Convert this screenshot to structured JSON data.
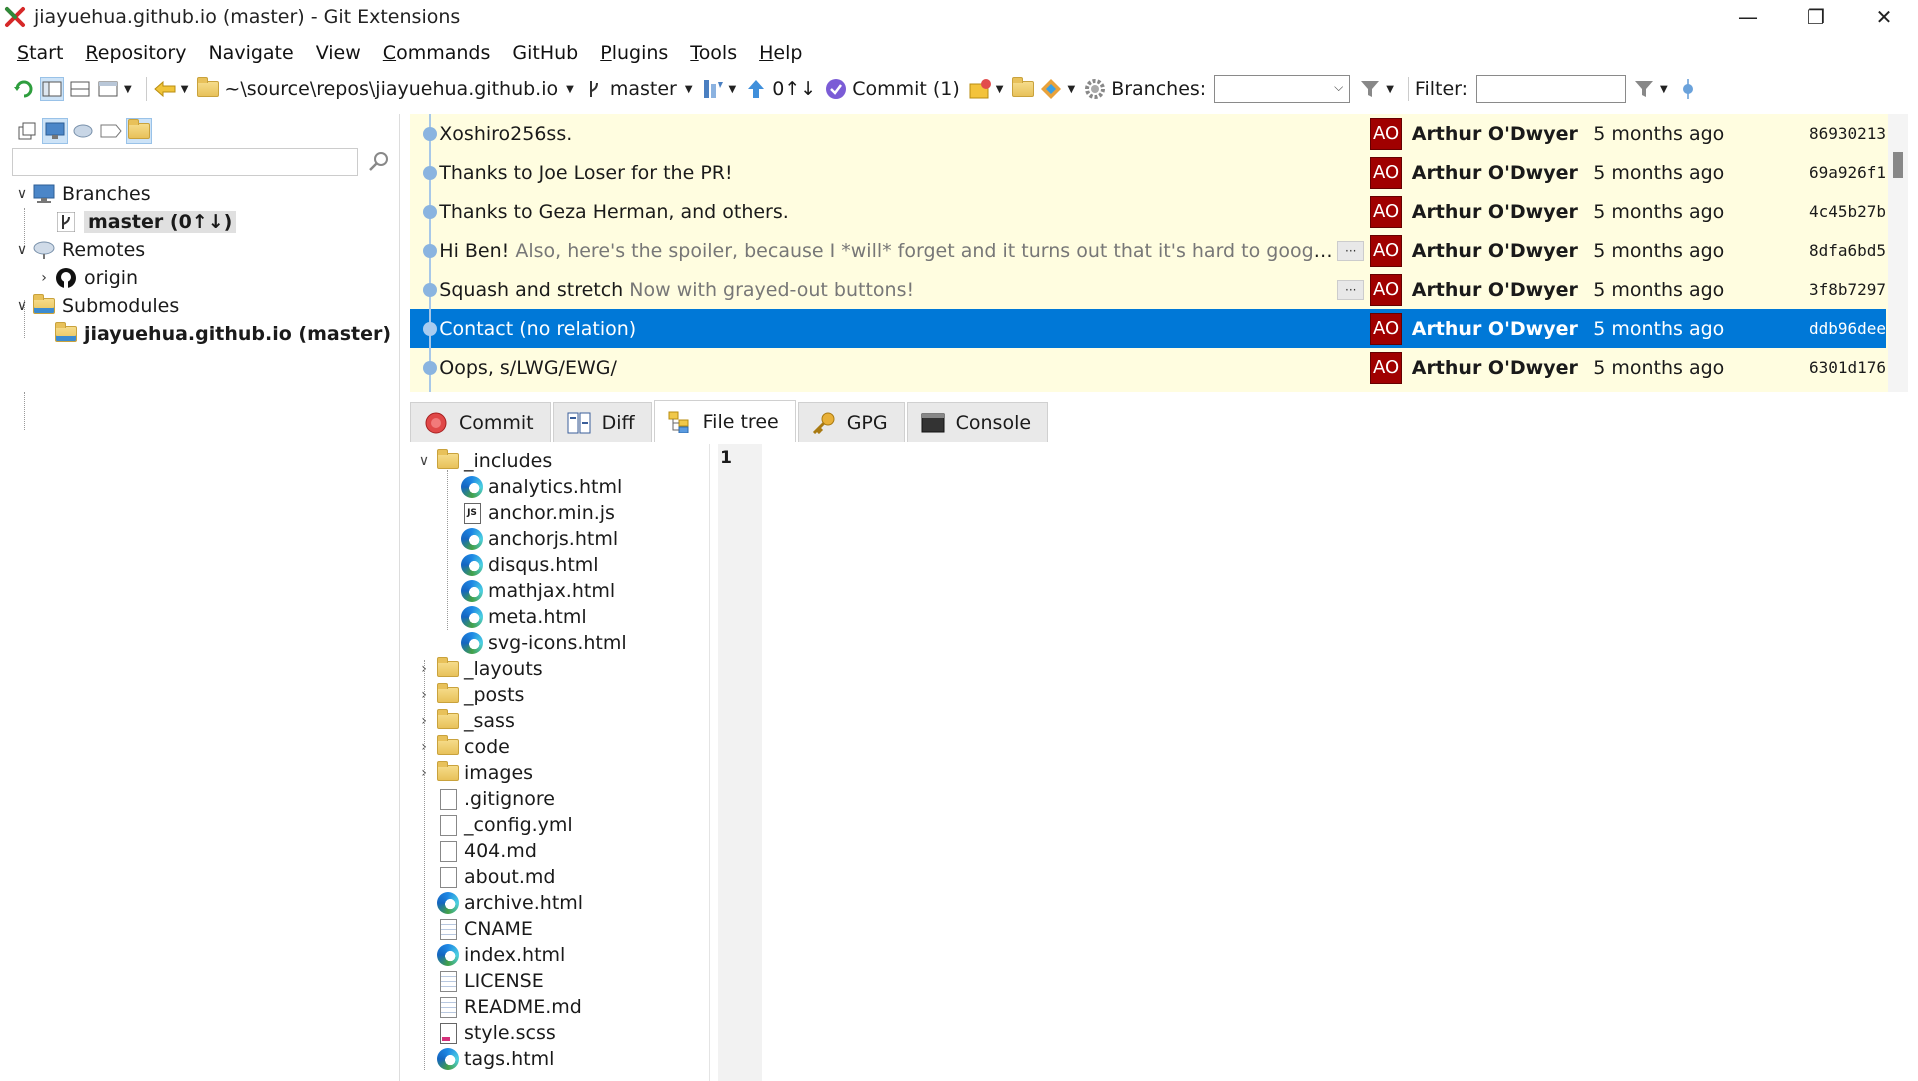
{
  "window": {
    "title": "jiayuehua.github.io (master) - Git Extensions",
    "minimize": "—",
    "restore": "❐",
    "close": "✕"
  },
  "menu": [
    {
      "label": "Start",
      "u": "S",
      "rest": "tart"
    },
    {
      "label": "Repository",
      "u": "R",
      "rest": "epository"
    },
    {
      "label": "Navigate",
      "u": "",
      "rest": "Navigate"
    },
    {
      "label": "View",
      "u": "",
      "rest": "View"
    },
    {
      "label": "Commands",
      "u": "C",
      "rest": "ommands"
    },
    {
      "label": "GitHub",
      "u": "",
      "rest": "GitHub"
    },
    {
      "label": "Plugins",
      "u": "P",
      "rest": "lugins"
    },
    {
      "label": "Tools",
      "u": "T",
      "rest": "ools"
    },
    {
      "label": "Help",
      "u": "H",
      "rest": "elp"
    }
  ],
  "toolbar": {
    "repo_path": "~\\source\\repos\\jiayuehua.github.io",
    "branch": "master",
    "ahead_behind": "0↑↓",
    "commit_label": "Commit (1)",
    "branches_label": "Branches:",
    "filter_label": "Filter:",
    "branches_value": "",
    "filter_value": ""
  },
  "left_panel": {
    "search_value": "",
    "tree": [
      {
        "label": "Branches",
        "level": 0,
        "chev": "∨",
        "icon": "monitor-icon",
        "bold": false
      },
      {
        "label": "master (0↑↓)",
        "level": 1,
        "chev": "",
        "icon": "branch-icon",
        "bold": true,
        "selected": true
      },
      {
        "label": "Remotes",
        "level": 0,
        "chev": "∨",
        "icon": "cloud-icon",
        "bold": false
      },
      {
        "label": "origin",
        "level": 1,
        "chev": "›",
        "icon": "github-icon",
        "bold": false
      },
      {
        "label": "Submodules",
        "level": 0,
        "chev": "∨",
        "icon": "submodule-folder-icon",
        "bold": false
      },
      {
        "label": "jiayuehua.github.io (master)",
        "level": 1,
        "chev": "",
        "icon": "submodule-folder-icon",
        "bold": true
      }
    ]
  },
  "revisions": [
    {
      "message": "Xoshiro256ss.",
      "sub": "",
      "more": false,
      "avatar": "AO",
      "author": "Arthur O'Dwyer",
      "date": "5 months ago",
      "hash": "86930213"
    },
    {
      "message": "Thanks to Joe Loser for the PR!",
      "sub": "",
      "more": false,
      "avatar": "AO",
      "author": "Arthur O'Dwyer",
      "date": "5 months ago",
      "hash": "69a926f1"
    },
    {
      "message": "Thanks to Geza Herman, and others.",
      "sub": "",
      "more": false,
      "avatar": "AO",
      "author": "Arthur O'Dwyer",
      "date": "5 months ago",
      "hash": "4c45b27b"
    },
    {
      "message": "Hi Ben!",
      "sub": " Also, here's the spoiler, because I *will* forget and it turns out that it's hard to google: Silver ...",
      "more": true,
      "avatar": "AO",
      "author": "Arthur O'Dwyer",
      "date": "5 months ago",
      "hash": "8dfa6bd5"
    },
    {
      "message": "Squash and stretch",
      "sub": " Now with grayed-out buttons!",
      "more": true,
      "avatar": "AO",
      "author": "Arthur O'Dwyer",
      "date": "5 months ago",
      "hash": "3f8b7297"
    },
    {
      "message": "Contact (no relation)",
      "sub": "",
      "more": false,
      "avatar": "AO",
      "author": "Arthur O'Dwyer",
      "date": "5 months ago",
      "hash": "ddb96dee",
      "selected": true
    },
    {
      "message": "Oops, s/LWG/EWG/",
      "sub": "",
      "more": false,
      "avatar": "AO",
      "author": "Arthur O'Dwyer",
      "date": "5 months ago",
      "hash": "6301d176"
    }
  ],
  "tabs": [
    {
      "label": "Commit",
      "icon": "commit-icon"
    },
    {
      "label": "Diff",
      "icon": "diff-icon"
    },
    {
      "label": "File tree",
      "icon": "file-tree-icon",
      "active": true
    },
    {
      "label": "GPG",
      "icon": "key-icon"
    },
    {
      "label": "Console",
      "icon": "console-icon"
    }
  ],
  "file_tree": [
    {
      "name": "_includes",
      "level": 0,
      "type": "folder",
      "chev": "∨"
    },
    {
      "name": "analytics.html",
      "level": 1,
      "type": "html"
    },
    {
      "name": "anchor.min.js",
      "level": 1,
      "type": "js"
    },
    {
      "name": "anchorjs.html",
      "level": 1,
      "type": "html"
    },
    {
      "name": "disqus.html",
      "level": 1,
      "type": "html"
    },
    {
      "name": "mathjax.html",
      "level": 1,
      "type": "html"
    },
    {
      "name": "meta.html",
      "level": 1,
      "type": "html"
    },
    {
      "name": "svg-icons.html",
      "level": 1,
      "type": "html"
    },
    {
      "name": "_layouts",
      "level": 0,
      "type": "folder",
      "chev": "›"
    },
    {
      "name": "_posts",
      "level": 0,
      "type": "folder",
      "chev": "›"
    },
    {
      "name": "_sass",
      "level": 0,
      "type": "folder",
      "chev": "›"
    },
    {
      "name": "code",
      "level": 0,
      "type": "folder",
      "chev": "›"
    },
    {
      "name": "images",
      "level": 0,
      "type": "folder",
      "chev": "›"
    },
    {
      "name": ".gitignore",
      "level": 0,
      "type": "file"
    },
    {
      "name": "_config.yml",
      "level": 0,
      "type": "file"
    },
    {
      "name": "404.md",
      "level": 0,
      "type": "file"
    },
    {
      "name": "about.md",
      "level": 0,
      "type": "file"
    },
    {
      "name": "archive.html",
      "level": 0,
      "type": "html"
    },
    {
      "name": "CNAME",
      "level": 0,
      "type": "text"
    },
    {
      "name": "index.html",
      "level": 0,
      "type": "html"
    },
    {
      "name": "LICENSE",
      "level": 0,
      "type": "text"
    },
    {
      "name": "README.md",
      "level": 0,
      "type": "text"
    },
    {
      "name": "style.scss",
      "level": 0,
      "type": "scss"
    },
    {
      "name": "tags.html",
      "level": 0,
      "type": "html"
    }
  ],
  "viewer": {
    "line_number": "1"
  },
  "colors": {
    "selection": "#0078d7",
    "grid_bg": "#fffde0",
    "avatar_bg": "#a00000"
  }
}
